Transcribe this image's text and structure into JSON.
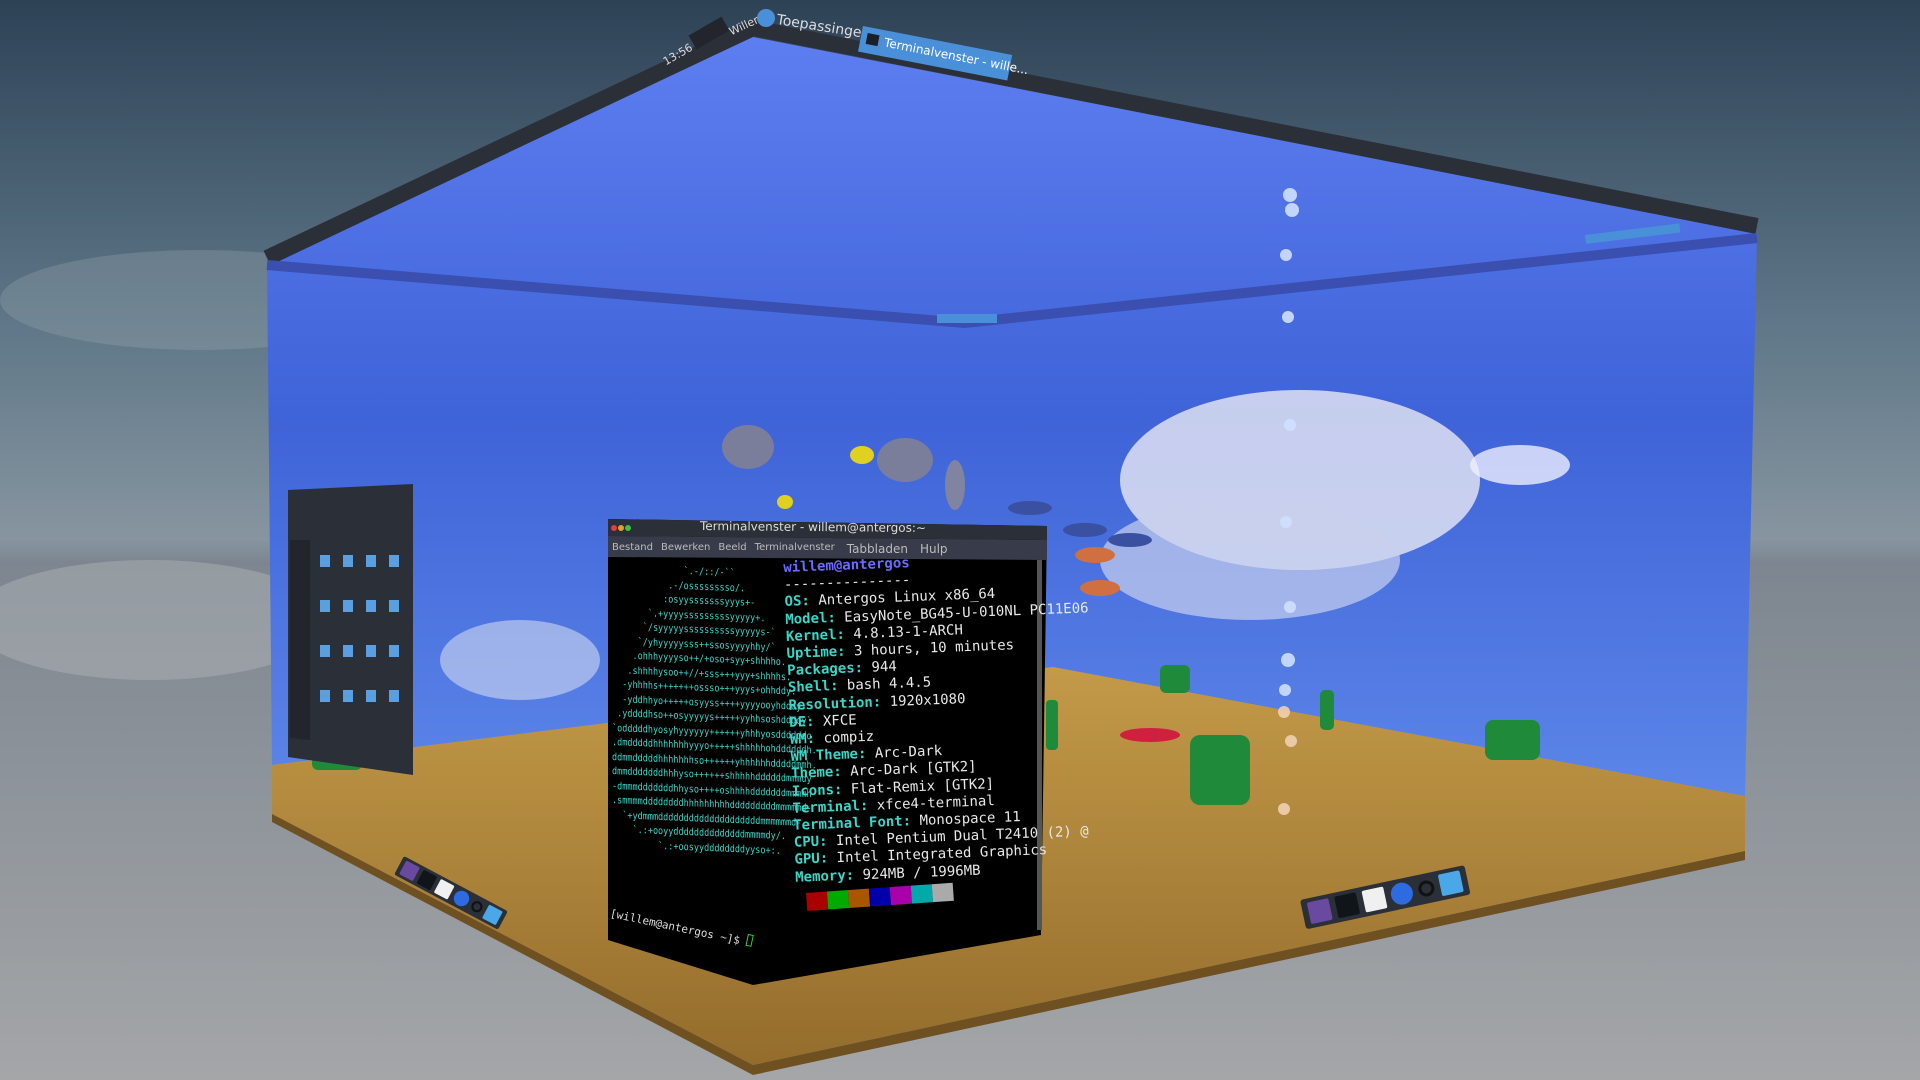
{
  "top_panel": {
    "clock": "13:56",
    "user": "Willem",
    "apps_menu": "Toepassingen",
    "task_button": "Terminalvenster - wille..."
  },
  "terminal": {
    "title": "Terminalvenster - willem@antergos:~",
    "menu": [
      "Bestand",
      "Bewerken",
      "Beeld",
      "Terminalvenster",
      "Tabbladen",
      "Hulp"
    ],
    "logo_lines": [
      "              `.-/::/-``",
      "           .-/osssssssso/.",
      "          :osyysssssssyyys+-",
      "       `.+yyyysssssssssyyyyy+.",
      "      `/syyyyyssssssssssyyyyys-`",
      "     `/yhyyyyysss++ssosyyyyhhy/`",
      "    .ohhhyyyyso++/+oso+syy+shhhho.",
      "   .shhhhysoo++//+sss+++yyy+shhhhs.",
      "  -yhhhhs+++++++ossso+++yyys+ohhddy:",
      "  -yddhhyo+++++osyyss++++yyyyooyhdddy-",
      " .yddddhso++osyyyyys+++++yyhhsoshddddy`",
      "`odddddhyosyhyyyyyy++++++yhhhyosddddddo",
      ".dmdddddhhhhhhhyyyo+++++shhhhhohddddddh.",
      "ddmmdddddhhhhhhhso++++++yhhhhhhdddddmmh.",
      "dmmdddddddhhhyso++++++shhhhhddddddmmmdy",
      "-dmmmdddddddhhyso++++oshhhhdddddddmmmmh",
      ".smmmmddddddddhhhhhhhhhdddddddddmmmmmd-",
      "  `+ydmmmddddddddddddddddddddmmmmmmd-",
      "    `.:+ooyyddddddddddddddmmmmdy/.",
      "         `.:+oosyyddddddddyyso+:."
    ],
    "user_host": "willem@antergos",
    "separator": "---------------",
    "info": [
      {
        "key": "OS",
        "value": "Antergos Linux x86_64"
      },
      {
        "key": "Model",
        "value": "EasyNote_BG45-U-010NL PC11E06"
      },
      {
        "key": "Kernel",
        "value": "4.8.13-1-ARCH"
      },
      {
        "key": "Uptime",
        "value": "3 hours, 10 minutes"
      },
      {
        "key": "Packages",
        "value": "944"
      },
      {
        "key": "Shell",
        "value": "bash 4.4.5"
      },
      {
        "key": "Resolution",
        "value": "1920x1080"
      },
      {
        "key": "DE",
        "value": "XFCE"
      },
      {
        "key": "WM",
        "value": "compiz"
      },
      {
        "key": "WM Theme",
        "value": "Arc-Dark"
      },
      {
        "key": "Theme",
        "value": "Arc-Dark [GTK2]"
      },
      {
        "key": "Icons",
        "value": "Flat-Remix [GTK2]"
      },
      {
        "key": "Terminal",
        "value": "xfce4-terminal"
      },
      {
        "key": "Terminal Font",
        "value": "Monospace 11"
      },
      {
        "key": "CPU",
        "value": "Intel Pentium Dual T2410 (2) @"
      },
      {
        "key": "GPU",
        "value": "Intel Integrated Graphics"
      },
      {
        "key": "Memory",
        "value": "924MB / 1996MB"
      }
    ],
    "prompt": "[willem@antergos ~]$",
    "palette": [
      "#aa0000",
      "#00aa00",
      "#aa5500",
      "#0000aa",
      "#aa00aa",
      "#00aaaa",
      "#aaaaaa"
    ]
  },
  "docks": {
    "icons": [
      "workspace-icon",
      "terminal-icon",
      "file-manager-icon",
      "browser-icon",
      "search-icon",
      "folder-icon"
    ]
  },
  "colors": {
    "panel": "#2b2f38",
    "accent": "#4a90d9",
    "sand": "#b0883c",
    "wallpaper": "#4f6ee0"
  }
}
